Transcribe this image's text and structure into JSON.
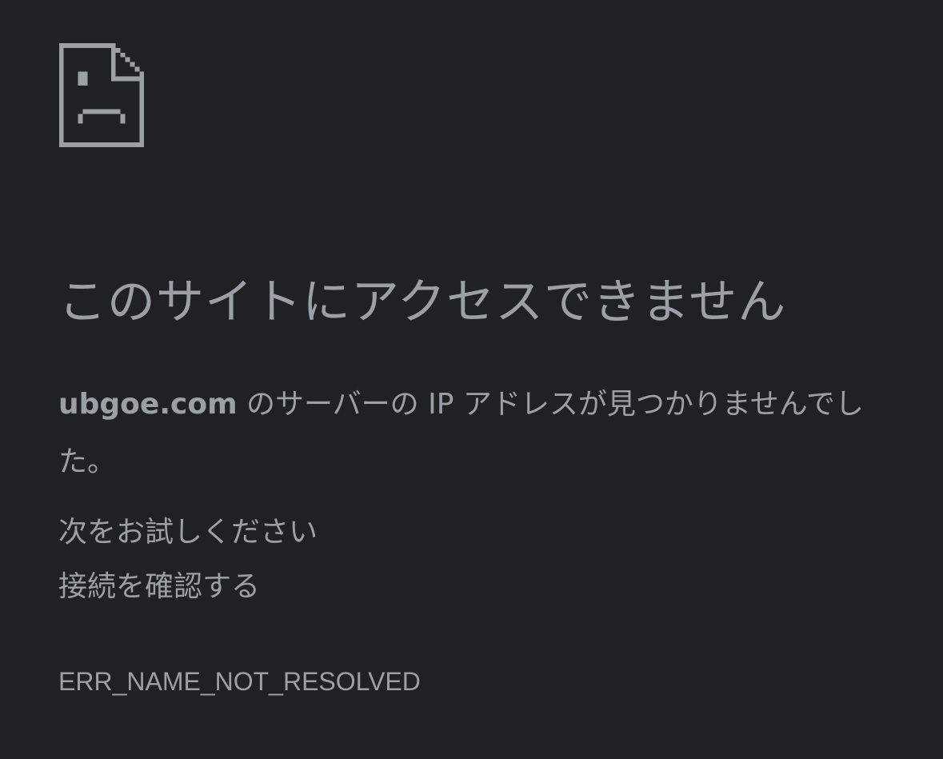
{
  "error": {
    "icon": "sad-document-icon",
    "title": "このサイトにアクセスできません",
    "summary": {
      "host": "ubgoe.com",
      "message": " のサーバーの IP アドレスが見つかりませんでした。"
    },
    "suggestions_heading": "次をお試しください",
    "suggestions": [
      "接続を確認する"
    ],
    "code": "ERR_NAME_NOT_RESOLVED"
  },
  "colors": {
    "background": "#202124",
    "text": "#9aa0a6"
  }
}
